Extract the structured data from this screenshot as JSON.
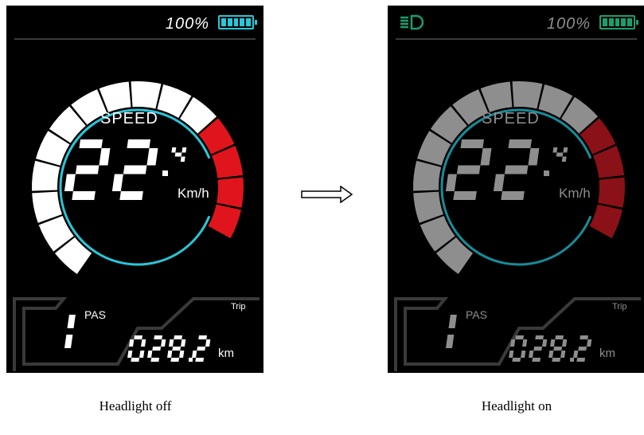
{
  "panels": [
    {
      "id": "off",
      "headlight_on": false,
      "battery_percent": "100%",
      "speed_label": "SPEED",
      "speed_value": "22",
      "speed_decimal": "4",
      "speed_unit": "Km/h",
      "pas_label": "PAS",
      "pas_level": "1",
      "trip_label": "Trip",
      "trip_value": "028.2",
      "trip_unit": "km",
      "colors": {
        "segment": "#ffffff",
        "accent": "#e0141c",
        "text": "#ffffff",
        "ring": "#29c6d8"
      }
    },
    {
      "id": "on",
      "headlight_on": true,
      "battery_percent": "100%",
      "speed_label": "SPEED",
      "speed_value": "22",
      "speed_decimal": "4",
      "speed_unit": "Km/h",
      "pas_label": "PAS",
      "pas_level": "1",
      "trip_label": "Trip",
      "trip_value": "028.2",
      "trip_unit": "km",
      "colors": {
        "segment": "#8e8e8e",
        "accent": "#8a1117",
        "text": "#8e8e8e",
        "ring": "#168c9a"
      }
    }
  ],
  "captions": {
    "off": "Headlight off",
    "on": "Headlight on"
  },
  "icons": {
    "arrow": "right-arrow-icon",
    "headlight": "headlight-icon",
    "battery": "battery-icon"
  }
}
